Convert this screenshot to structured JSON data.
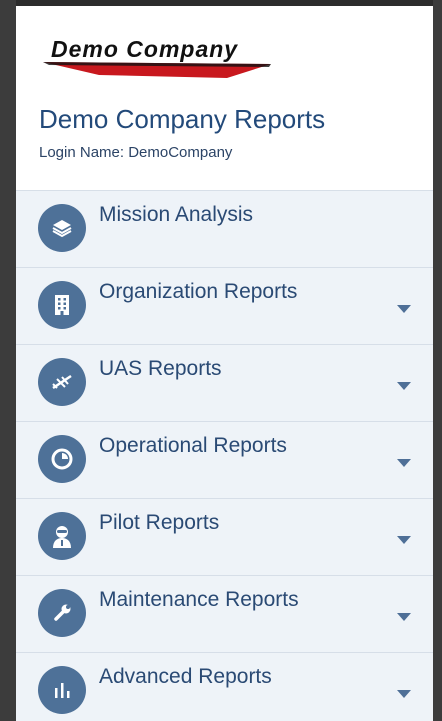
{
  "header": {
    "logo_text": "Demo Company",
    "title": "Demo Company Reports",
    "login_name": "Login Name: DemoCompany"
  },
  "menu": {
    "items": [
      {
        "label": "Mission Analysis",
        "icon": "layers-icon",
        "has_caret": false
      },
      {
        "label": "Organization Reports",
        "icon": "building-icon",
        "has_caret": true
      },
      {
        "label": "UAS Reports",
        "icon": "drone-icon",
        "has_caret": true
      },
      {
        "label": "Operational Reports",
        "icon": "pie-chart-icon",
        "has_caret": true
      },
      {
        "label": "Pilot Reports",
        "icon": "pilot-icon",
        "has_caret": true
      },
      {
        "label": "Maintenance Reports",
        "icon": "wrench-icon",
        "has_caret": true
      },
      {
        "label": "Advanced Reports",
        "icon": "bar-chart-icon",
        "has_caret": true
      }
    ]
  },
  "colors": {
    "accent": "#4e7198",
    "title": "#234a7a",
    "menu_background": "#eef3f8",
    "logo_swoosh": "#c8181e"
  }
}
